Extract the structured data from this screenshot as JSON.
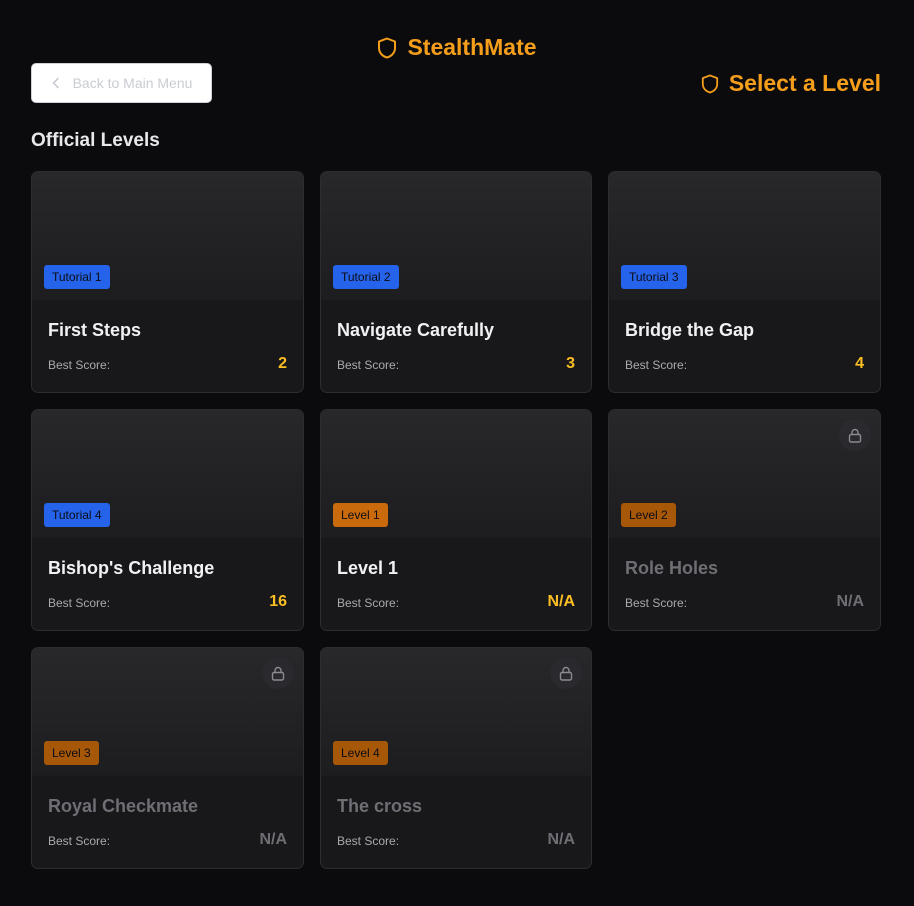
{
  "app": {
    "name": "StealthMate",
    "logo_icon": "shield-icon",
    "accent_color": "#f59e1b"
  },
  "header": {
    "back_label": "Back to Main Menu",
    "back_icon": "chevron-left-icon",
    "title": "Select a Level",
    "title_icon": "shield-icon"
  },
  "section": {
    "title": "Official Levels"
  },
  "levels": [
    {
      "badge": "Tutorial 1",
      "badge_type": "tutorial",
      "title": "First Steps",
      "score_label": "Best Score:",
      "score": "2",
      "locked": false
    },
    {
      "badge": "Tutorial 2",
      "badge_type": "tutorial",
      "title": "Navigate Carefully",
      "score_label": "Best Score:",
      "score": "3",
      "locked": false
    },
    {
      "badge": "Tutorial 3",
      "badge_type": "tutorial",
      "title": "Bridge the Gap",
      "score_label": "Best Score:",
      "score": "4",
      "locked": false
    },
    {
      "badge": "Tutorial 4",
      "badge_type": "tutorial",
      "title": "Bishop's Challenge",
      "score_label": "Best Score:",
      "score": "16",
      "locked": false
    },
    {
      "badge": "Level 1",
      "badge_type": "level",
      "title": "Level 1",
      "score_label": "Best Score:",
      "score": "N/A",
      "locked": false
    },
    {
      "badge": "Level 2",
      "badge_type": "level",
      "title": "Role Holes",
      "score_label": "Best Score:",
      "score": "N/A",
      "locked": true
    },
    {
      "badge": "Level 3",
      "badge_type": "level",
      "title": "Royal Checkmate",
      "score_label": "Best Score:",
      "score": "N/A",
      "locked": true
    },
    {
      "badge": "Level 4",
      "badge_type": "level",
      "title": "The cross",
      "score_label": "Best Score:",
      "score": "N/A",
      "locked": true
    }
  ],
  "colors": {
    "tutorial_badge": "#2563eb",
    "level_badge": "#c96a0c",
    "score": "#fbbf24",
    "background": "#0b0b0d"
  }
}
